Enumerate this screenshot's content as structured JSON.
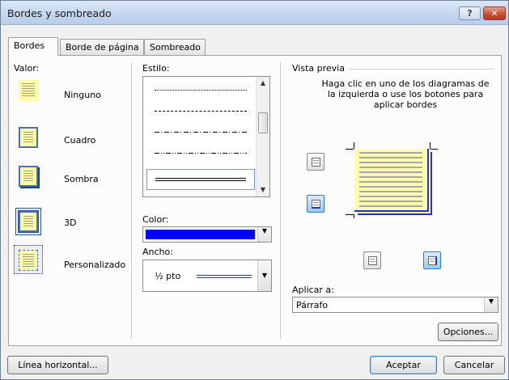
{
  "window": {
    "title": "Bordes y sombreado",
    "help_label": "?",
    "close_label": "✕"
  },
  "tabs": [
    {
      "label": "Bordes",
      "active": true
    },
    {
      "label": "Borde de página",
      "active": false
    },
    {
      "label": "Sombreado",
      "active": false
    }
  ],
  "valor": {
    "label": "Valor:",
    "items": [
      {
        "label": "Ninguno",
        "selected": false
      },
      {
        "label": "Cuadro",
        "selected": false
      },
      {
        "label": "Sombra",
        "selected": false
      },
      {
        "label": "3D",
        "selected": false
      },
      {
        "label": "Personalizado",
        "selected": true
      }
    ]
  },
  "estilo": {
    "label": "Estilo:",
    "options": [
      "dotted",
      "dashed",
      "dash-dot",
      "dash-dot-dot",
      "double"
    ],
    "selected": "double"
  },
  "color": {
    "label": "Color:",
    "value": "#0000ff"
  },
  "ancho": {
    "label": "Ancho:",
    "value": "½ pto"
  },
  "preview": {
    "title": "Vista previa",
    "hint": "Haga clic en uno de los diagramas de la izquierda o use los botones para aplicar bordes",
    "border_color": "#1f33c4"
  },
  "aplicar": {
    "label": "Aplicar a:",
    "value": "Párrafo"
  },
  "buttons": {
    "opciones": "Opciones...",
    "linea_horizontal": "Línea horizontal...",
    "aceptar": "Aceptar",
    "cancelar": "Cancelar"
  }
}
